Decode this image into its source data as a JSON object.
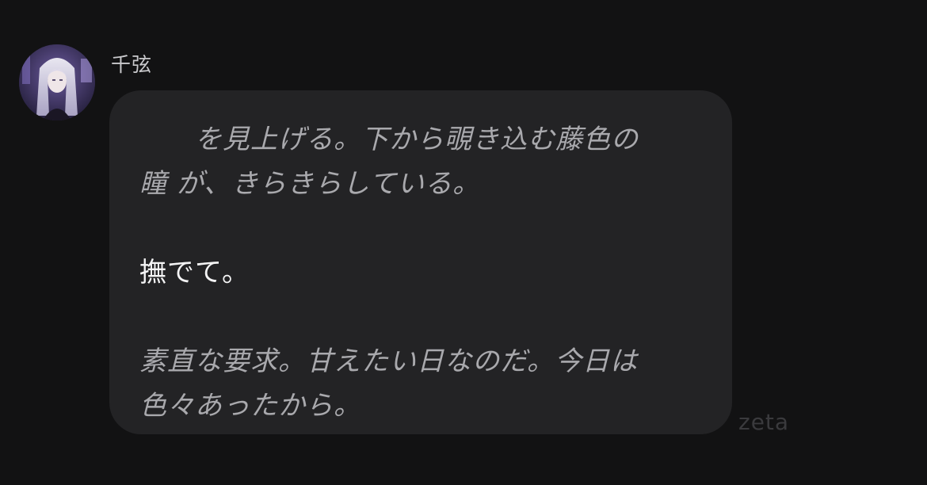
{
  "message": {
    "sender_name": "千弦",
    "avatar": "character-portrait",
    "paragraphs": [
      {
        "kind": "narration",
        "lines": [
          "　　を見上げる。下から覗き込む藤色の",
          "瞳 が、きらきらしている。"
        ]
      },
      {
        "kind": "dialogue",
        "lines": [
          "撫でて。"
        ]
      },
      {
        "kind": "narration",
        "lines": [
          "素直な要求。甘えたい日なのだ。今日は",
          "色々あったから。"
        ]
      }
    ]
  },
  "watermark": "zeta",
  "colors": {
    "background": "#121213",
    "bubble": "#232325",
    "narration_text": "#a9a9ad",
    "dialogue_text": "#f4f4f5",
    "watermark": "#3a3a3d"
  }
}
